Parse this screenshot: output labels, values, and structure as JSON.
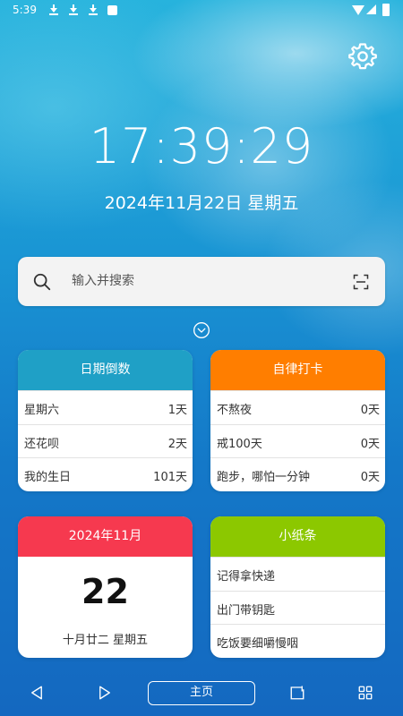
{
  "status_bar": {
    "time": "5:39"
  },
  "clock": {
    "time": "17:39:29",
    "date": "2024年11月22日 星期五"
  },
  "search": {
    "placeholder": "输入并搜索",
    "value": ""
  },
  "cards": {
    "countdown": {
      "title": "日期倒数",
      "color": "#1fa0c6",
      "rows": [
        {
          "label": "星期六",
          "value": "1天"
        },
        {
          "label": "还花呗",
          "value": "2天"
        },
        {
          "label": "我的生日",
          "value": "101天"
        }
      ]
    },
    "checkin": {
      "title": "自律打卡",
      "color": "#ff7e00",
      "rows": [
        {
          "label": "不熬夜",
          "value": "0天"
        },
        {
          "label": "戒100天",
          "value": "0天"
        },
        {
          "label": "跑步，哪怕一分钟",
          "value": "0天"
        }
      ]
    },
    "calendar": {
      "title": "2024年11月",
      "color": "#f6394f",
      "day": "22",
      "lunar_weekday": "十月廿二  星期五"
    },
    "notes": {
      "title": "小纸条",
      "color": "#8cc800",
      "items": [
        "记得拿快递",
        "出门带钥匙",
        "吃饭要细嚼慢咽"
      ]
    }
  },
  "nav": {
    "home_label": "主页"
  },
  "icons": [
    "gear-icon",
    "search-icon",
    "scan-icon",
    "chevron-down-circle-icon",
    "back-icon",
    "forward-icon",
    "tab-icon",
    "apps-grid-icon"
  ]
}
